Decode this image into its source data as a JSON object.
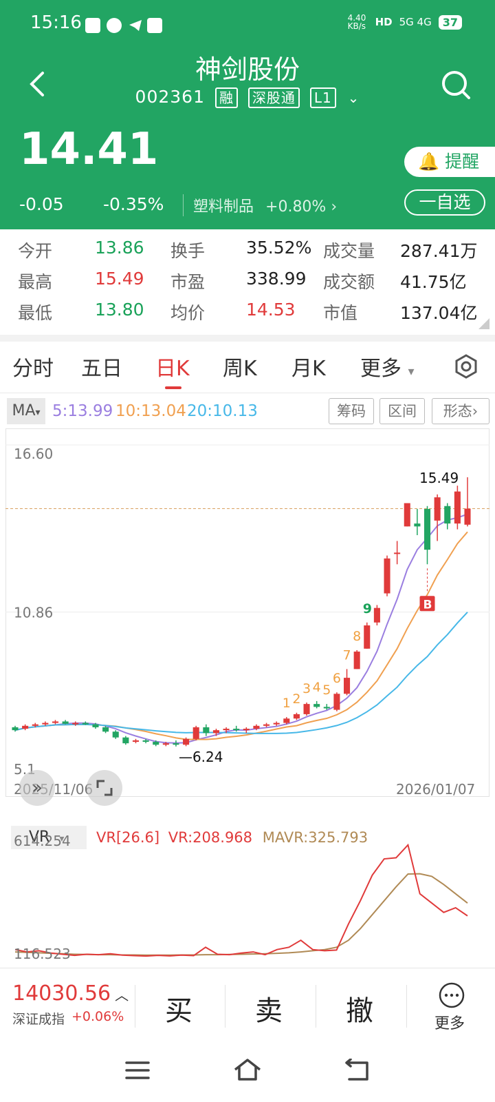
{
  "status_bar": {
    "time": "15:16",
    "net_speed": "4.40 KB/s",
    "signal": "5G 4G",
    "battery": "37"
  },
  "header": {
    "name": "神剑股份",
    "code": "002361",
    "tags": [
      "融",
      "深股通",
      "L1"
    ],
    "price": "14.41",
    "change": "-0.05",
    "change_pct": "-0.35%",
    "sector": "塑料制品",
    "sector_change": "+0.80%",
    "alert_label": "提醒",
    "watchlist_label": "一自选"
  },
  "stats": {
    "open_label": "今开",
    "open": "13.86",
    "high_label": "最高",
    "high": "15.49",
    "low_label": "最低",
    "low": "13.80",
    "turnover_label": "换手",
    "turnover": "35.52%",
    "pe_label": "市盈",
    "pe": "338.99",
    "avg_label": "均价",
    "avg": "14.53",
    "volume_label": "成交量",
    "volume": "287.41万",
    "amount_label": "成交额",
    "amount": "41.75亿",
    "mcap_label": "市值",
    "mcap": "137.04亿"
  },
  "tabs": [
    "分时",
    "五日",
    "日K",
    "周K",
    "月K",
    "更多"
  ],
  "ma_legend": {
    "button": "MA",
    "ma5": "5:13.99",
    "ma10": "10:13.04",
    "ma20": "20:10.13"
  },
  "tool_buttons": [
    "筹码",
    "区间",
    "形态"
  ],
  "colors": {
    "green": "#22a563",
    "red": "#e03a3a",
    "ma5": "#9a7ee0",
    "ma10": "#f0a050",
    "ma20": "#47b8e8"
  },
  "chart_data": {
    "type": "candlestick",
    "y_axis_labels": [
      "16.60",
      "10.86",
      "5.1"
    ],
    "x_axis_labels": [
      "2025/11/06",
      "2026/01/07"
    ],
    "ylim": [
      5.1,
      16.6
    ],
    "high_marker": "15.49",
    "low_marker": "6.24",
    "signal_labels": [
      "1",
      "2",
      "3",
      "4",
      "5",
      "6",
      "7",
      "8",
      "9"
    ],
    "buy_marker": "B",
    "candles": [
      [
        6.9,
        6.95,
        6.75,
        6.8
      ],
      [
        6.85,
        7.0,
        6.8,
        6.95
      ],
      [
        6.95,
        7.05,
        6.9,
        7.0
      ],
      [
        7.0,
        7.1,
        6.95,
        7.05
      ],
      [
        7.05,
        7.15,
        7.0,
        7.1
      ],
      [
        7.1,
        7.15,
        7.0,
        7.02
      ],
      [
        7.0,
        7.1,
        6.95,
        7.05
      ],
      [
        7.05,
        7.1,
        6.98,
        7.0
      ],
      [
        7.0,
        7.05,
        6.85,
        6.9
      ],
      [
        6.9,
        6.95,
        6.7,
        6.75
      ],
      [
        6.75,
        6.8,
        6.5,
        6.55
      ],
      [
        6.55,
        6.6,
        6.3,
        6.35
      ],
      [
        6.4,
        6.5,
        6.35,
        6.45
      ],
      [
        6.45,
        6.5,
        6.35,
        6.4
      ],
      [
        6.4,
        6.45,
        6.25,
        6.3
      ],
      [
        6.3,
        6.4,
        6.25,
        6.35
      ],
      [
        6.35,
        6.45,
        6.24,
        6.3
      ],
      [
        6.3,
        6.55,
        6.25,
        6.5
      ],
      [
        6.5,
        6.95,
        6.45,
        6.9
      ],
      [
        6.9,
        7.0,
        6.6,
        6.7
      ],
      [
        6.7,
        6.85,
        6.6,
        6.8
      ],
      [
        6.8,
        6.9,
        6.7,
        6.85
      ],
      [
        6.85,
        6.95,
        6.75,
        6.8
      ],
      [
        6.8,
        6.9,
        6.7,
        6.85
      ],
      [
        6.85,
        7.0,
        6.8,
        6.95
      ],
      [
        6.95,
        7.05,
        6.9,
        7.0
      ],
      [
        7.0,
        7.1,
        6.95,
        7.05
      ],
      [
        7.05,
        7.25,
        7.0,
        7.2
      ],
      [
        7.2,
        7.4,
        7.15,
        7.35
      ],
      [
        7.35,
        7.75,
        7.3,
        7.7
      ],
      [
        7.7,
        7.8,
        7.55,
        7.6
      ],
      [
        7.6,
        7.7,
        7.5,
        7.55
      ],
      [
        7.5,
        8.1,
        7.45,
        8.05
      ],
      [
        8.05,
        8.9,
        8.0,
        8.6
      ],
      [
        8.9,
        9.55,
        8.9,
        9.5
      ],
      [
        9.6,
        10.5,
        9.6,
        10.4
      ],
      [
        10.5,
        11.1,
        10.4,
        11.0
      ],
      [
        11.5,
        12.8,
        11.4,
        12.7
      ],
      [
        12.9,
        13.3,
        12.5,
        12.9
      ],
      [
        13.8,
        14.6,
        13.8,
        14.6
      ],
      [
        13.9,
        14.4,
        13.5,
        13.8
      ],
      [
        14.4,
        14.5,
        12.5,
        13.0
      ],
      [
        14.0,
        14.9,
        13.3,
        14.8
      ],
      [
        14.5,
        14.6,
        13.7,
        13.9
      ],
      [
        13.9,
        15.2,
        13.7,
        15.0
      ],
      [
        13.86,
        15.49,
        13.8,
        14.41
      ]
    ]
  },
  "indicator": {
    "name": "VR",
    "legend_param": "VR[26.6]",
    "vr": "VR:208.968",
    "mavr": "MAVR:325.793",
    "max_label": "614.254",
    "min_label": "116.523",
    "vr_values": [
      150,
      140,
      145,
      135,
      130,
      125,
      130,
      128,
      132,
      126,
      124,
      122,
      125,
      123,
      126,
      124,
      160,
      130,
      128,
      135,
      140,
      128,
      150,
      160,
      190,
      150,
      145,
      148,
      260,
      360,
      470,
      540,
      545,
      600,
      390,
      350,
      310,
      330,
      295
    ],
    "mavr_values": [
      140,
      138,
      136,
      134,
      132,
      130,
      129,
      128,
      128,
      127,
      127,
      126,
      126,
      126,
      127,
      127,
      128,
      128,
      129,
      130,
      131,
      132,
      134,
      136,
      140,
      145,
      150,
      160,
      190,
      240,
      300,
      360,
      420,
      475,
      476,
      465,
      430,
      390,
      350
    ]
  },
  "bottom_bar": {
    "index_value": "14030.56",
    "index_name": "深证成指",
    "index_change": "+0.06%",
    "buy": "买",
    "sell": "卖",
    "cancel": "撤",
    "more": "更多"
  }
}
